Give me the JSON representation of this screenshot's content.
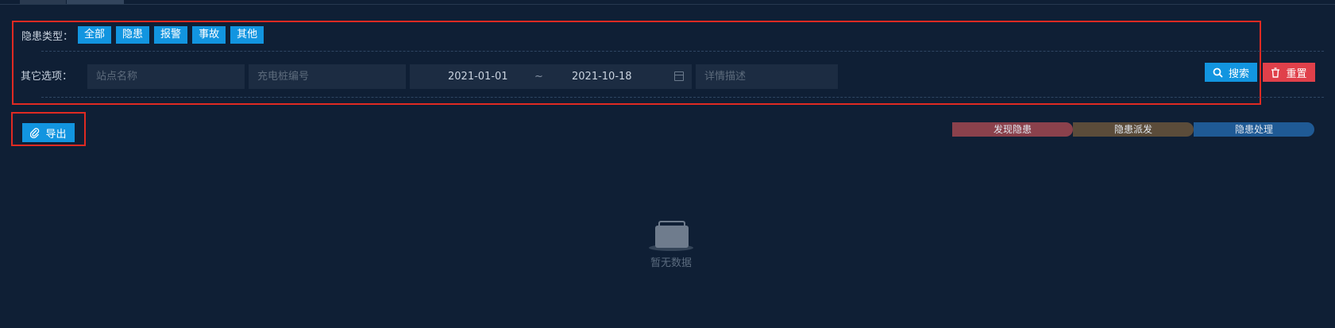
{
  "filter": {
    "type_label": "隐患类型：",
    "type_buttons": [
      "全部",
      "隐患",
      "报警",
      "事故",
      "其他"
    ],
    "other_label": "其它选项：",
    "station_placeholder": "站点名称",
    "pile_placeholder": "充电桩编号",
    "date_start": "2021-01-01",
    "date_separator": "~",
    "date_end": "2021-10-18",
    "desc_placeholder": "详情描述",
    "search_label": "搜索",
    "reset_label": "重置"
  },
  "toolbar": {
    "export_label": "导出"
  },
  "legend": {
    "items": [
      {
        "label": "发现隐患",
        "color": "#8b414c"
      },
      {
        "label": "隐患派发",
        "color": "#5b4c3a"
      },
      {
        "label": "隐患处理",
        "color": "#1f5a95"
      }
    ]
  },
  "empty": {
    "text": "暂无数据"
  },
  "icons": {
    "search": "search-icon",
    "reset": "trash-icon",
    "export": "paperclip-icon",
    "calendar": "calendar-icon",
    "empty": "empty-inbox-icon"
  },
  "colors": {
    "primary": "#1295e0",
    "danger": "#e0404a",
    "highlight_border": "#e02a22",
    "background": "#0f1f35"
  }
}
